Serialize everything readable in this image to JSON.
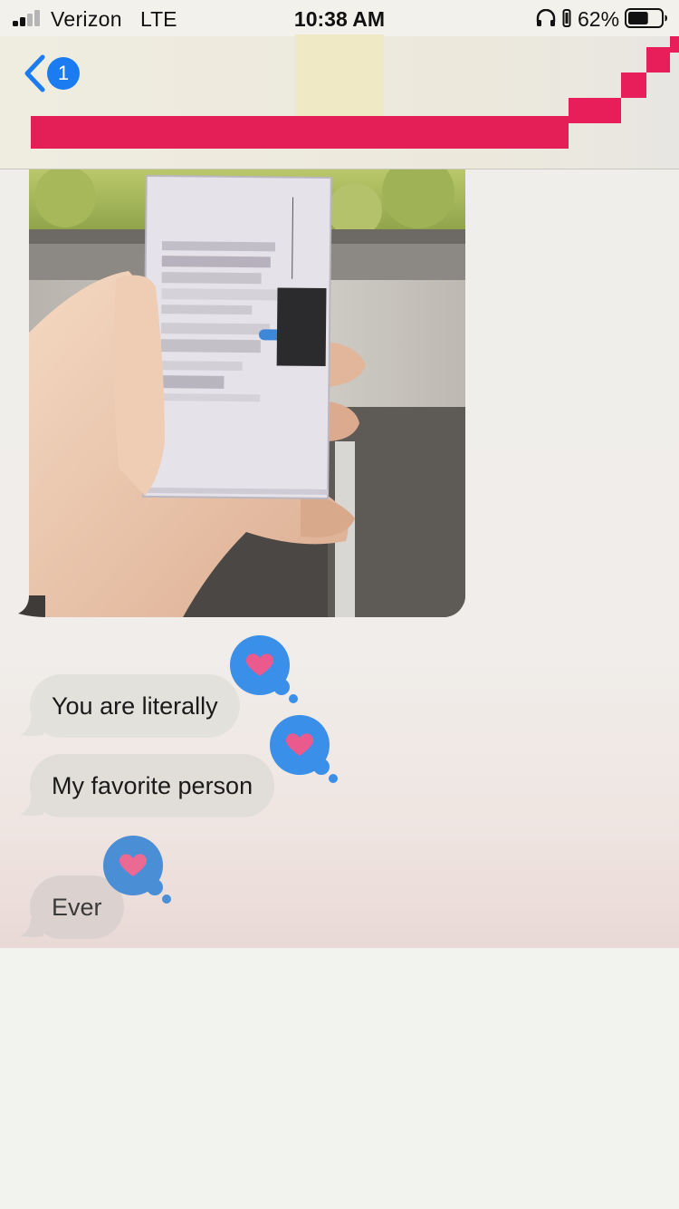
{
  "status_bar": {
    "carrier": "Verizon",
    "network": "LTE",
    "time": "10:38 AM",
    "battery_percent": "62%",
    "battery_level": 0.62,
    "icons": [
      "signal-icon",
      "headphones-icon",
      "orientation-lock-icon",
      "battery-icon"
    ]
  },
  "header": {
    "back_badge_count": "1",
    "back_icon": "chevron-left-icon"
  },
  "messages": [
    {
      "type": "image",
      "direction": "received",
      "description_icon": "photo-attachment"
    },
    {
      "type": "text",
      "direction": "received",
      "text": "You are literally",
      "tapback": "heart"
    },
    {
      "type": "text",
      "direction": "received",
      "text": "My favorite person",
      "tapback": "heart"
    },
    {
      "type": "text",
      "direction": "received",
      "text": "Ever",
      "tapback": "heart"
    }
  ],
  "colors": {
    "accent_blue": "#1b7cf2",
    "tapback_blue": "#3a8fe8",
    "heart_pink": "#ea5a8c",
    "received_bubble": "#e3e1dc",
    "redaction_pink": "#e41e57"
  }
}
